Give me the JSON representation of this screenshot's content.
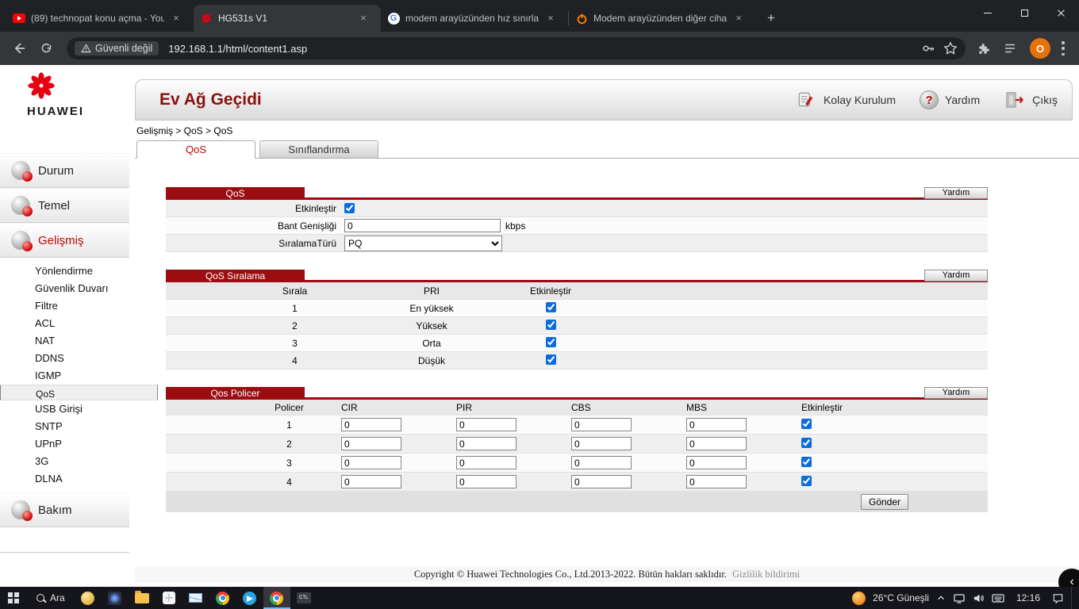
{
  "browser": {
    "tabs": [
      {
        "title": "(89) technopat konu açma - You",
        "icon": "youtube"
      },
      {
        "title": "HG531s V1",
        "icon": "huawei"
      },
      {
        "title": "modem arayüzünden hız sınırla",
        "icon": "google"
      },
      {
        "title": "Modem arayüzünden diğer ciha",
        "icon": "technopat"
      }
    ],
    "tab_close_glyph": "×",
    "new_tab_label": "+",
    "toolbar": {
      "security_chip": "Güvenli değil",
      "url": "192.168.1.1/html/content1.asp",
      "profile_initial": "O",
      "google_g": "G"
    }
  },
  "app": {
    "brand": "HUAWEI",
    "header": {
      "title": "Ev Ağ Geçidi",
      "easy_setup": "Kolay Kurulum",
      "help": "Yardım",
      "help_glyph": "?",
      "logout": "Çıkış"
    },
    "sidebar": {
      "main_items": [
        "Durum",
        "Temel",
        "Gelişmiş",
        "Bakım"
      ],
      "sub_items": [
        "Yönlendirme",
        "Güvenlik Duvarı",
        "Filtre",
        "ACL",
        "NAT",
        "DDNS",
        "IGMP",
        "QoS",
        "USB Girişi",
        "SNTP",
        "UPnP",
        "3G",
        "DLNA"
      ]
    },
    "breadcrumb": "Gelişmiş > QoS > QoS",
    "tabs": {
      "qos": "QoS",
      "classification": "Sınıflandırma"
    },
    "help_button": "Yardım",
    "qos": {
      "title": "QoS",
      "enable_label": "Etkinleştir",
      "enable_checked": true,
      "bandwidth_label": "Bant Genişliği",
      "bandwidth_value": "0",
      "bandwidth_unit": "kbps",
      "queue_type_label": "SıralamaTürü",
      "queue_type_value": "PQ"
    },
    "queue": {
      "title": "QoS Sıralama",
      "columns": [
        "Sırala",
        "PRI",
        "Etkinleştir"
      ],
      "rows": [
        {
          "num": "1",
          "pri": "En yüksek",
          "enabled": true
        },
        {
          "num": "2",
          "pri": "Yüksek",
          "enabled": true
        },
        {
          "num": "3",
          "pri": "Orta",
          "enabled": true
        },
        {
          "num": "4",
          "pri": "Düşük",
          "enabled": true
        }
      ]
    },
    "policer": {
      "title": "Qos Policer",
      "columns": [
        "Policer",
        "CIR",
        "PIR",
        "CBS",
        "MBS",
        "Etkinleştir"
      ],
      "rows": [
        {
          "num": "1",
          "cir": "0",
          "pir": "0",
          "cbs": "0",
          "mbs": "0",
          "enabled": true
        },
        {
          "num": "2",
          "cir": "0",
          "pir": "0",
          "cbs": "0",
          "mbs": "0",
          "enabled": true
        },
        {
          "num": "3",
          "cir": "0",
          "pir": "0",
          "cbs": "0",
          "mbs": "0",
          "enabled": true
        },
        {
          "num": "4",
          "cir": "0",
          "pir": "0",
          "cbs": "0",
          "mbs": "0",
          "enabled": true
        }
      ],
      "submit_label": "Gönder"
    },
    "footer": {
      "copyright": "Copyright © Huawei Technologies Co., Ltd.2013-2022. Bütün hakları saklıdır.",
      "privacy": "Gizlilik bildirimi"
    }
  },
  "taskbar": {
    "search": "Ara",
    "terminal_label": "CTL",
    "weather": "26°C Güneşli",
    "time": "12:16"
  },
  "overlay": {
    "collapse_glyph": "‹"
  }
}
